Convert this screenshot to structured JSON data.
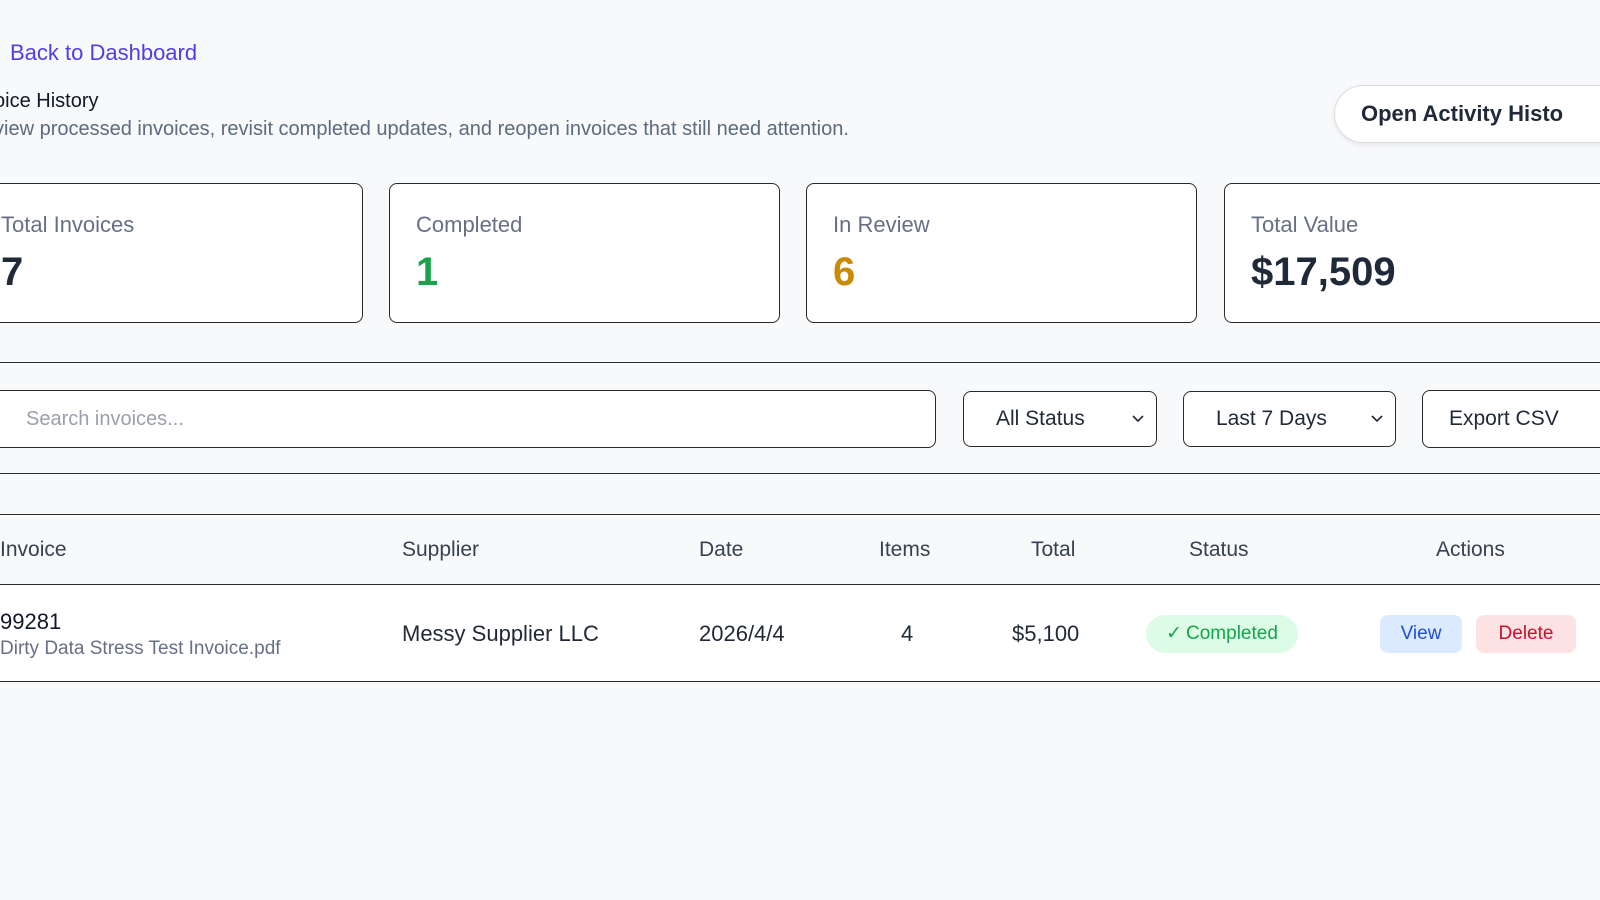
{
  "nav": {
    "back_label": "Back to Dashboard"
  },
  "header": {
    "title": "oice History",
    "subtitle": "view processed invoices, revisit completed updates, and reopen invoices that still need attention.",
    "activity_button": "Open Activity Histo"
  },
  "stats": [
    {
      "label": "Total Invoices",
      "value": "7"
    },
    {
      "label": "Completed",
      "value": "1"
    },
    {
      "label": "In Review",
      "value": "6"
    },
    {
      "label": "Total Value",
      "value": "$17,509"
    }
  ],
  "filters": {
    "search_placeholder": "Search invoices...",
    "status_selected": "All Status",
    "range_selected": "Last 7 Days",
    "export_label": "Export CSV"
  },
  "table": {
    "headers": [
      "Invoice",
      "Supplier",
      "Date",
      "Items",
      "Total",
      "Status",
      "Actions"
    ],
    "rows": [
      {
        "invoice_number": "99281",
        "file_name": "Dirty Data Stress Test Invoice.pdf",
        "supplier": "Messy Supplier LLC",
        "date": "2026/4/4",
        "items": "4",
        "total": "$5,100",
        "status": "Completed",
        "view_label": "View",
        "delete_label": "Delete"
      }
    ]
  },
  "colors": {
    "accent": "#4f3ee6",
    "completed": "#16a34a",
    "review": "#ca8a04",
    "view": "#1d4ed8",
    "delete": "#c8102e"
  },
  "icons": {
    "status_check": "check-icon",
    "dropdown": "chevron-down-icon"
  }
}
